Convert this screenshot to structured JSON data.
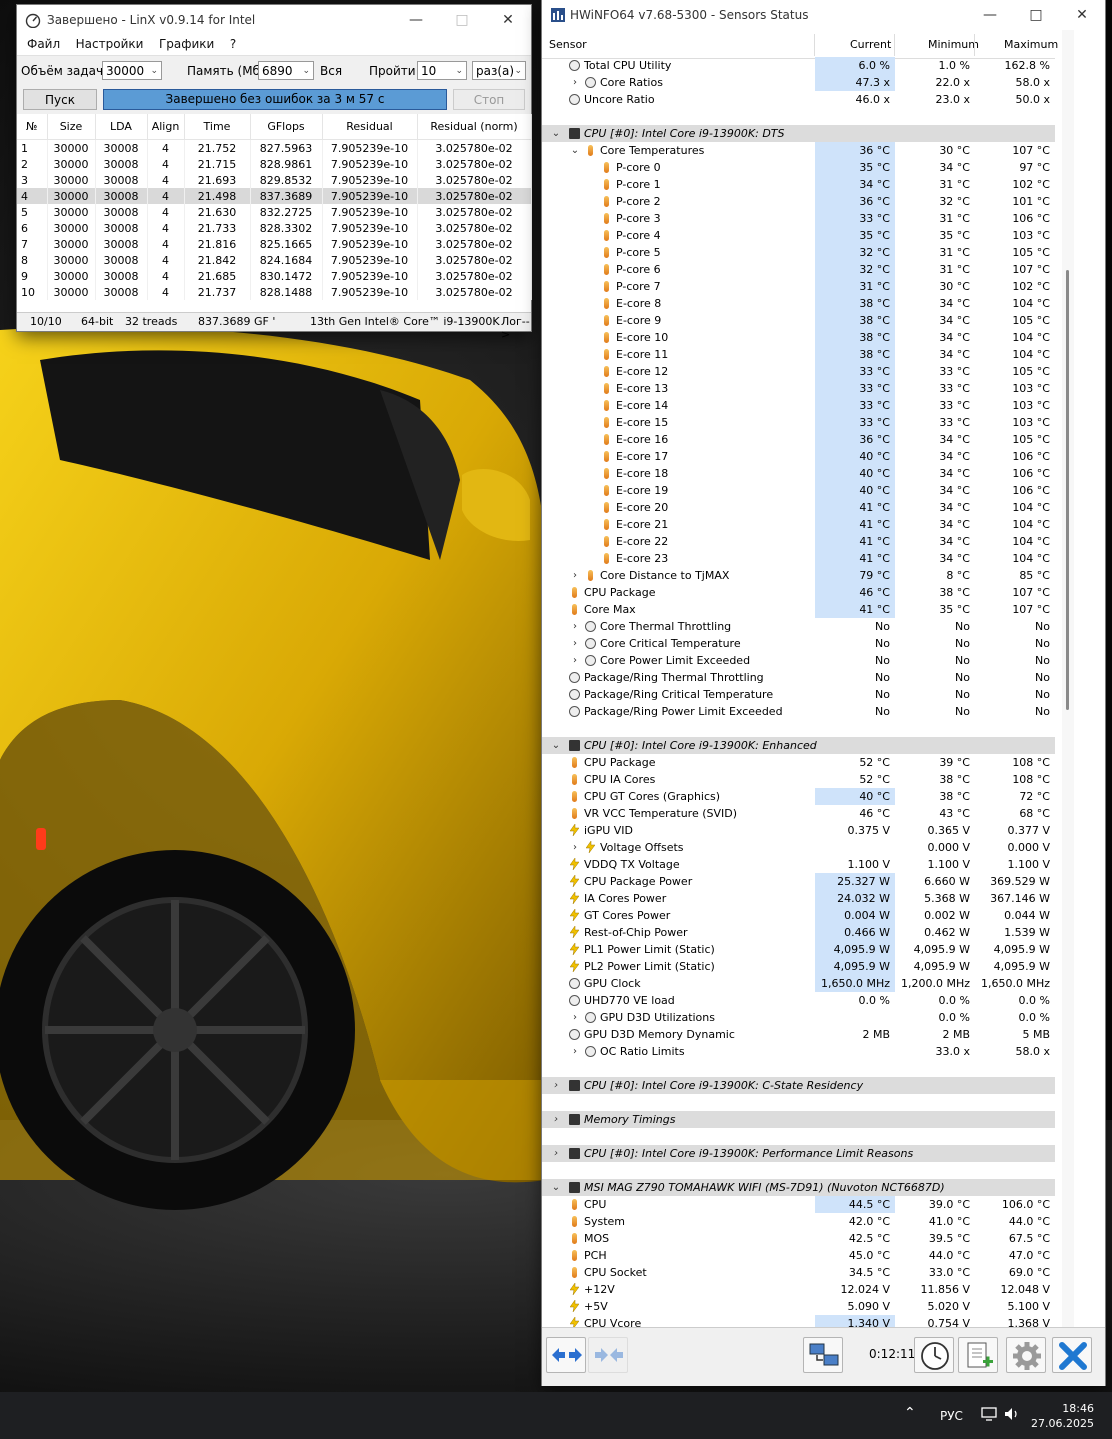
{
  "linx": {
    "title": "Завершено - LinX v0.9.14 for Intel",
    "menu": [
      "Файл",
      "Настройки",
      "Графики",
      "?"
    ],
    "problem_size_label": "Объём задачи:",
    "problem_size_value": "30000",
    "memory_label": "Память (Мб):",
    "memory_value": "6890",
    "memory_all_label": "Вся",
    "runs_label": "Пройти:",
    "runs_value": "10",
    "runs_unit": "раз(а)",
    "start_label": "Пуск",
    "progress_text": "Завершено без ошибок за 3 м 57 с",
    "progress_fraction": 1.0,
    "stop_label": "Стоп",
    "columns": [
      "№",
      "Size",
      "LDA",
      "Align",
      "Time",
      "GFlops",
      "Residual",
      "Residual (norm)"
    ],
    "rows": [
      [
        "1",
        "30000",
        "30008",
        "4",
        "21.752",
        "827.5963",
        "7.905239e-10",
        "3.025780e-02"
      ],
      [
        "2",
        "30000",
        "30008",
        "4",
        "21.715",
        "828.9861",
        "7.905239e-10",
        "3.025780e-02"
      ],
      [
        "3",
        "30000",
        "30008",
        "4",
        "21.693",
        "829.8532",
        "7.905239e-10",
        "3.025780e-02"
      ],
      [
        "4",
        "30000",
        "30008",
        "4",
        "21.498",
        "837.3689",
        "7.905239e-10",
        "3.025780e-02"
      ],
      [
        "5",
        "30000",
        "30008",
        "4",
        "21.630",
        "832.2725",
        "7.905239e-10",
        "3.025780e-02"
      ],
      [
        "6",
        "30000",
        "30008",
        "4",
        "21.733",
        "828.3302",
        "7.905239e-10",
        "3.025780e-02"
      ],
      [
        "7",
        "30000",
        "30008",
        "4",
        "21.816",
        "825.1665",
        "7.905239e-10",
        "3.025780e-02"
      ],
      [
        "8",
        "30000",
        "30008",
        "4",
        "21.842",
        "824.1684",
        "7.905239e-10",
        "3.025780e-02"
      ],
      [
        "9",
        "30000",
        "30008",
        "4",
        "21.685",
        "830.1472",
        "7.905239e-10",
        "3.025780e-02"
      ],
      [
        "10",
        "30000",
        "30008",
        "4",
        "21.737",
        "828.1488",
        "7.905239e-10",
        "3.025780e-02"
      ]
    ],
    "selected_row": 3,
    "status": {
      "runs": "10/10",
      "bits": "64-bit",
      "threads": "32 treads",
      "peak": "837.3689 GF '",
      "cpu": "13th Gen Intel® Core™ i9-13900K",
      "log": "Лог-->"
    }
  },
  "hwinfo": {
    "title": "HWiNFO64 v7.68-5300 - Sensors Status",
    "columns": {
      "sensor": "Sensor",
      "current": "Current",
      "minimum": "Minimum",
      "maximum": "Maximum"
    },
    "rows": [
      {
        "t": "circle",
        "i": 1,
        "name": "Total CPU Utility",
        "cur": "6.0 %",
        "min": "1.0 %",
        "max": "162.8 %",
        "hl": true
      },
      {
        "t": "circle",
        "i": 2,
        "exp": ">",
        "name": "Core Ratios",
        "cur": "47.3 x",
        "min": "22.0 x",
        "max": "58.0 x",
        "hl": true
      },
      {
        "t": "circle",
        "i": 1,
        "name": "Uncore Ratio",
        "cur": "46.0 x",
        "min": "23.0 x",
        "max": "50.0 x"
      },
      {
        "t": "blank"
      },
      {
        "t": "group",
        "exp": "v",
        "name": "CPU [#0]: Intel Core i9-13900K: DTS"
      },
      {
        "t": "thermo",
        "i": 2,
        "exp": "v",
        "name": "Core Temperatures",
        "cur": "36 °C",
        "min": "30 °C",
        "max": "107 °C",
        "hl": true
      },
      {
        "t": "thermo",
        "i": 3,
        "name": "P-core 0",
        "cur": "35 °C",
        "min": "34 °C",
        "max": "97 °C",
        "hl": true
      },
      {
        "t": "thermo",
        "i": 3,
        "name": "P-core 1",
        "cur": "34 °C",
        "min": "31 °C",
        "max": "102 °C",
        "hl": true
      },
      {
        "t": "thermo",
        "i": 3,
        "name": "P-core 2",
        "cur": "36 °C",
        "min": "32 °C",
        "max": "101 °C",
        "hl": true
      },
      {
        "t": "thermo",
        "i": 3,
        "name": "P-core 3",
        "cur": "33 °C",
        "min": "31 °C",
        "max": "106 °C",
        "hl": true
      },
      {
        "t": "thermo",
        "i": 3,
        "name": "P-core 4",
        "cur": "35 °C",
        "min": "35 °C",
        "max": "103 °C",
        "hl": true
      },
      {
        "t": "thermo",
        "i": 3,
        "name": "P-core 5",
        "cur": "32 °C",
        "min": "31 °C",
        "max": "105 °C",
        "hl": true
      },
      {
        "t": "thermo",
        "i": 3,
        "name": "P-core 6",
        "cur": "32 °C",
        "min": "31 °C",
        "max": "107 °C",
        "hl": true
      },
      {
        "t": "thermo",
        "i": 3,
        "name": "P-core 7",
        "cur": "31 °C",
        "min": "30 °C",
        "max": "102 °C",
        "hl": true
      },
      {
        "t": "thermo",
        "i": 3,
        "name": "E-core 8",
        "cur": "38 °C",
        "min": "34 °C",
        "max": "104 °C",
        "hl": true
      },
      {
        "t": "thermo",
        "i": 3,
        "name": "E-core 9",
        "cur": "38 °C",
        "min": "34 °C",
        "max": "105 °C",
        "hl": true
      },
      {
        "t": "thermo",
        "i": 3,
        "name": "E-core 10",
        "cur": "38 °C",
        "min": "34 °C",
        "max": "104 °C",
        "hl": true
      },
      {
        "t": "thermo",
        "i": 3,
        "name": "E-core 11",
        "cur": "38 °C",
        "min": "34 °C",
        "max": "104 °C",
        "hl": true
      },
      {
        "t": "thermo",
        "i": 3,
        "name": "E-core 12",
        "cur": "33 °C",
        "min": "33 °C",
        "max": "105 °C",
        "hl": true
      },
      {
        "t": "thermo",
        "i": 3,
        "name": "E-core 13",
        "cur": "33 °C",
        "min": "33 °C",
        "max": "103 °C",
        "hl": true
      },
      {
        "t": "thermo",
        "i": 3,
        "name": "E-core 14",
        "cur": "33 °C",
        "min": "33 °C",
        "max": "103 °C",
        "hl": true
      },
      {
        "t": "thermo",
        "i": 3,
        "name": "E-core 15",
        "cur": "33 °C",
        "min": "33 °C",
        "max": "103 °C",
        "hl": true
      },
      {
        "t": "thermo",
        "i": 3,
        "name": "E-core 16",
        "cur": "36 °C",
        "min": "34 °C",
        "max": "105 °C",
        "hl": true
      },
      {
        "t": "thermo",
        "i": 3,
        "name": "E-core 17",
        "cur": "40 °C",
        "min": "34 °C",
        "max": "106 °C",
        "hl": true
      },
      {
        "t": "thermo",
        "i": 3,
        "name": "E-core 18",
        "cur": "40 °C",
        "min": "34 °C",
        "max": "106 °C",
        "hl": true
      },
      {
        "t": "thermo",
        "i": 3,
        "name": "E-core 19",
        "cur": "40 °C",
        "min": "34 °C",
        "max": "106 °C",
        "hl": true
      },
      {
        "t": "thermo",
        "i": 3,
        "name": "E-core 20",
        "cur": "41 °C",
        "min": "34 °C",
        "max": "104 °C",
        "hl": true
      },
      {
        "t": "thermo",
        "i": 3,
        "name": "E-core 21",
        "cur": "41 °C",
        "min": "34 °C",
        "max": "104 °C",
        "hl": true
      },
      {
        "t": "thermo",
        "i": 3,
        "name": "E-core 22",
        "cur": "41 °C",
        "min": "34 °C",
        "max": "104 °C",
        "hl": true
      },
      {
        "t": "thermo",
        "i": 3,
        "name": "E-core 23",
        "cur": "41 °C",
        "min": "34 °C",
        "max": "104 °C",
        "hl": true
      },
      {
        "t": "thermo",
        "i": 2,
        "exp": ">",
        "name": "Core Distance to TjMAX",
        "cur": "79 °C",
        "min": "8 °C",
        "max": "85 °C",
        "hl": true
      },
      {
        "t": "thermo",
        "i": 1,
        "name": "CPU Package",
        "cur": "46 °C",
        "min": "38 °C",
        "max": "107 °C",
        "hl": true
      },
      {
        "t": "thermo",
        "i": 1,
        "name": "Core Max",
        "cur": "41 °C",
        "min": "35 °C",
        "max": "107 °C",
        "hl": true
      },
      {
        "t": "circle",
        "i": 2,
        "exp": ">",
        "name": "Core Thermal Throttling",
        "cur": "No",
        "min": "No",
        "max": "No"
      },
      {
        "t": "circle",
        "i": 2,
        "exp": ">",
        "name": "Core Critical Temperature",
        "cur": "No",
        "min": "No",
        "max": "No"
      },
      {
        "t": "circle",
        "i": 2,
        "exp": ">",
        "name": "Core Power Limit Exceeded",
        "cur": "No",
        "min": "No",
        "max": "No"
      },
      {
        "t": "circle",
        "i": 1,
        "name": "Package/Ring Thermal Throttling",
        "cur": "No",
        "min": "No",
        "max": "No"
      },
      {
        "t": "circle",
        "i": 1,
        "name": "Package/Ring Critical Temperature",
        "cur": "No",
        "min": "No",
        "max": "No"
      },
      {
        "t": "circle",
        "i": 1,
        "name": "Package/Ring Power Limit Exceeded",
        "cur": "No",
        "min": "No",
        "max": "No"
      },
      {
        "t": "blank"
      },
      {
        "t": "group",
        "exp": "v",
        "name": "CPU [#0]: Intel Core i9-13900K: Enhanced"
      },
      {
        "t": "thermo",
        "i": 1,
        "name": "CPU Package",
        "cur": "52 °C",
        "min": "39 °C",
        "max": "108 °C"
      },
      {
        "t": "thermo",
        "i": 1,
        "name": "CPU IA Cores",
        "cur": "52 °C",
        "min": "38 °C",
        "max": "108 °C"
      },
      {
        "t": "thermo",
        "i": 1,
        "name": "CPU GT Cores (Graphics)",
        "cur": "40 °C",
        "min": "38 °C",
        "max": "72 °C",
        "hl": true
      },
      {
        "t": "thermo",
        "i": 1,
        "name": "VR VCC Temperature (SVID)",
        "cur": "46 °C",
        "min": "43 °C",
        "max": "68 °C"
      },
      {
        "t": "bolt",
        "i": 1,
        "name": "iGPU VID",
        "cur": "0.375 V",
        "min": "0.365 V",
        "max": "0.377 V"
      },
      {
        "t": "bolt",
        "i": 2,
        "exp": ">",
        "name": "Voltage Offsets",
        "cur": "",
        "min": "0.000 V",
        "max": "0.000 V"
      },
      {
        "t": "bolt",
        "i": 1,
        "name": "VDDQ TX Voltage",
        "cur": "1.100 V",
        "min": "1.100 V",
        "max": "1.100 V"
      },
      {
        "t": "bolt",
        "i": 1,
        "name": "CPU Package Power",
        "cur": "25.327 W",
        "min": "6.660 W",
        "max": "369.529 W",
        "hl": true
      },
      {
        "t": "bolt",
        "i": 1,
        "name": "IA Cores Power",
        "cur": "24.032 W",
        "min": "5.368 W",
        "max": "367.146 W",
        "hl": true
      },
      {
        "t": "bolt",
        "i": 1,
        "name": "GT Cores Power",
        "cur": "0.004 W",
        "min": "0.002 W",
        "max": "0.044 W",
        "hl": true
      },
      {
        "t": "bolt",
        "i": 1,
        "name": "Rest-of-Chip Power",
        "cur": "0.466 W",
        "min": "0.462 W",
        "max": "1.539 W",
        "hl": true
      },
      {
        "t": "bolt",
        "i": 1,
        "name": "PL1 Power Limit (Static)",
        "cur": "4,095.9 W",
        "min": "4,095.9 W",
        "max": "4,095.9 W",
        "hl": true
      },
      {
        "t": "bolt",
        "i": 1,
        "name": "PL2 Power Limit (Static)",
        "cur": "4,095.9 W",
        "min": "4,095.9 W",
        "max": "4,095.9 W",
        "hl": true
      },
      {
        "t": "circle",
        "i": 1,
        "name": "GPU Clock",
        "cur": "1,650.0 MHz",
        "min": "1,200.0 MHz",
        "max": "1,650.0 MHz",
        "hl": true
      },
      {
        "t": "circle",
        "i": 1,
        "name": "UHD770 VE load",
        "cur": "0.0 %",
        "min": "0.0 %",
        "max": "0.0 %"
      },
      {
        "t": "circle",
        "i": 2,
        "exp": ">",
        "name": "GPU D3D Utilizations",
        "cur": "",
        "min": "0.0 %",
        "max": "0.0 %"
      },
      {
        "t": "circle",
        "i": 1,
        "name": "GPU D3D Memory Dynamic",
        "cur": "2 MB",
        "min": "2 MB",
        "max": "5 MB"
      },
      {
        "t": "circle",
        "i": 2,
        "exp": ">",
        "name": "OC Ratio Limits",
        "cur": "",
        "min": "33.0 x",
        "max": "58.0 x"
      },
      {
        "t": "blank"
      },
      {
        "t": "group",
        "exp": ">",
        "name": "CPU [#0]: Intel Core i9-13900K: C-State Residency"
      },
      {
        "t": "blank"
      },
      {
        "t": "group",
        "exp": ">",
        "name": "Memory Timings"
      },
      {
        "t": "blank"
      },
      {
        "t": "group",
        "exp": ">",
        "name": "CPU [#0]: Intel Core i9-13900K: Performance Limit Reasons"
      },
      {
        "t": "blank"
      },
      {
        "t": "group",
        "exp": "v",
        "name": "MSI MAG Z790 TOMAHAWK WIFI (MS-7D91) (Nuvoton NCT6687D)"
      },
      {
        "t": "thermo",
        "i": 1,
        "name": "CPU",
        "cur": "44.5 °C",
        "min": "39.0 °C",
        "max": "106.0 °C",
        "hl": true
      },
      {
        "t": "thermo",
        "i": 1,
        "name": "System",
        "cur": "42.0 °C",
        "min": "41.0 °C",
        "max": "44.0 °C"
      },
      {
        "t": "thermo",
        "i": 1,
        "name": "MOS",
        "cur": "42.5 °C",
        "min": "39.5 °C",
        "max": "67.5 °C"
      },
      {
        "t": "thermo",
        "i": 1,
        "name": "PCH",
        "cur": "45.0 °C",
        "min": "44.0 °C",
        "max": "47.0 °C"
      },
      {
        "t": "thermo",
        "i": 1,
        "name": "CPU Socket",
        "cur": "34.5 °C",
        "min": "33.0 °C",
        "max": "69.0 °C"
      },
      {
        "t": "bolt",
        "i": 1,
        "name": "+12V",
        "cur": "12.024 V",
        "min": "11.856 V",
        "max": "12.048 V"
      },
      {
        "t": "bolt",
        "i": 1,
        "name": "+5V",
        "cur": "5.090 V",
        "min": "5.020 V",
        "max": "5.100 V"
      },
      {
        "t": "bolt",
        "i": 1,
        "name": "CPU Vcore",
        "cur": "1.340 V",
        "min": "0.754 V",
        "max": "1.368 V",
        "hl": true
      }
    ],
    "timer": "0:12:11"
  },
  "taskbar": {
    "language": "РУС",
    "time": "18:46",
    "date": "27.06.2025"
  }
}
